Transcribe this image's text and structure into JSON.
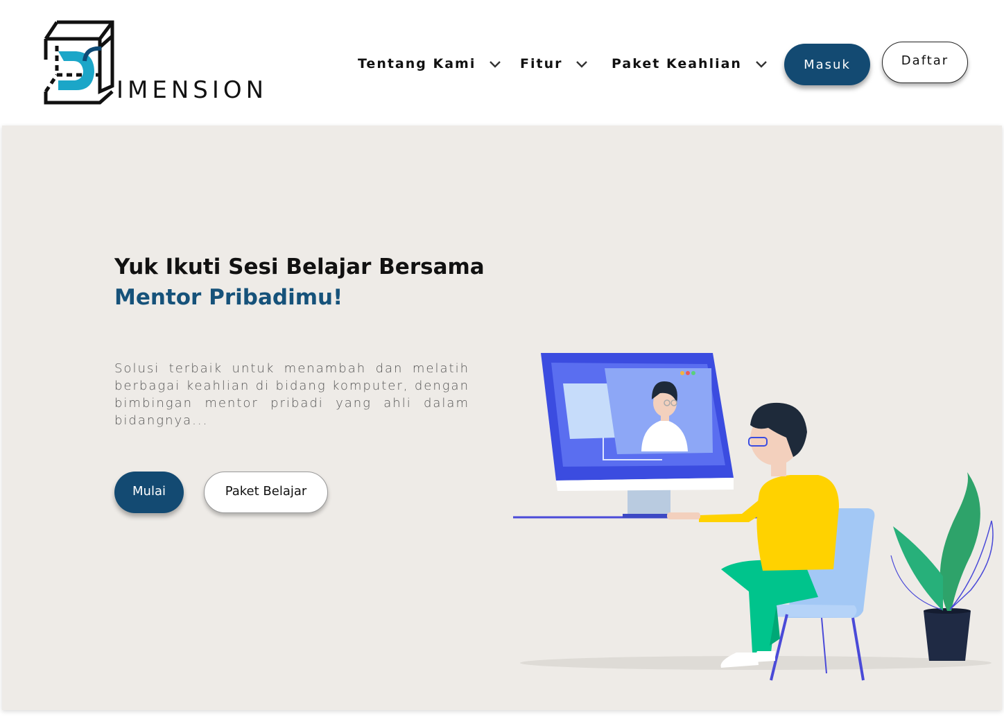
{
  "brand": {
    "name": "IMENSION",
    "accent": "#1ba6c8",
    "primary": "#134a72"
  },
  "nav": {
    "items": [
      {
        "label": "Tentang Kami",
        "icon": "chevron-down-icon"
      },
      {
        "label": "Fitur",
        "icon": "chevron-down-icon"
      },
      {
        "label": "Paket Keahlian",
        "icon": "chevron-down-icon"
      }
    ],
    "login_label": "Masuk",
    "register_label": "Daftar"
  },
  "hero": {
    "title_line1": "Yuk Ikuti Sesi Belajar Bersama",
    "title_line2": "Mentor Pribadimu!",
    "description": "Solusi terbaik untuk menambah dan melatih berbagai keahlian di bidang komputer, dengan bimbingan mentor pribadi yang ahli dalam bidangnya...",
    "primary_cta": "Mulai",
    "secondary_cta": "Paket Belajar",
    "background": "#eeebe7"
  }
}
